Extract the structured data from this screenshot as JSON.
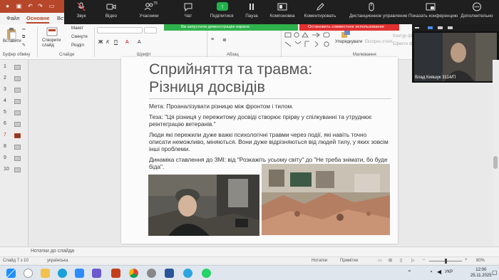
{
  "zoom": {
    "buttons": [
      {
        "label": "Звук",
        "icon": "mic-muted-icon"
      },
      {
        "label": "Відео",
        "icon": "video-camera-icon"
      },
      {
        "label": "Учасники",
        "icon": "participants-icon",
        "count": "75"
      },
      {
        "label": "Чат",
        "icon": "chat-icon"
      },
      {
        "label": "Поділитися",
        "icon": "share-screen-icon"
      },
      {
        "label": "Пауза",
        "icon": "pause-icon"
      },
      {
        "label": "Компоновка",
        "icon": "layout-icon"
      },
      {
        "label": "Коментировать",
        "icon": "annotate-icon"
      },
      {
        "label": "Дистанционное управление",
        "icon": "remote-control-icon"
      },
      {
        "label": "Показать конференцию",
        "icon": "show-meeting-icon"
      },
      {
        "label": "Дополнительно",
        "icon": "more-icon"
      }
    ],
    "share_banner": "Ви запустили демонстрацію екрана",
    "stop_share": "Остановить совместное использование",
    "participant_name": "Влад Кияшук 3114/П"
  },
  "ppt": {
    "tabs": [
      "Файл",
      "Основне",
      "Вст"
    ],
    "ribbon": {
      "paste": "Вставити",
      "new_slide": "Створити слайд",
      "layout": "Макет",
      "reset": "Скинути",
      "section": "Розділ",
      "arrange": "Упорядкувати",
      "quick_styles": "Експрес-стилі",
      "shape_outline": "Контур фігури",
      "shape_effects": "Ефекти фігур",
      "groups": {
        "clipboard": "Буфер обміну",
        "slides": "Слайди",
        "font": "Шрифт",
        "paragraph": "Абзац",
        "drawing": "Малювання"
      }
    },
    "slide_numbers": [
      "1",
      "2",
      "3",
      "4",
      "5",
      "6",
      "7",
      "8",
      "9",
      "10"
    ],
    "active_slide": "7",
    "slide": {
      "title_line1": "Сприйняття та травма:",
      "title_line2": "Різниця досвідів",
      "goal": "Мета: Проаналізувати різницю між фронтом і тилом.",
      "thesis": "Теза: \"Ця різниця у пережитому досвіді створює прірву у спілкуванні та утруднює реінтеграцію ветеранів.\"",
      "paragraph": "Люди які пережили дуже важкі психологічні травми через події, які навіть точно описати неможливо, міняються. Вони дуже відрізняються від людей тилу, у яких зовсім інші проблеми.",
      "media": "Динаміка ставлення до ЗМІ: від \"Розкажіть усьому світу\" до \"Не треба знімати, бо буде біда\"."
    },
    "notes_placeholder": "Нотатки до слайда",
    "status": {
      "slide_counter": "Слайд 7 з 10",
      "language": "українська",
      "notes": "Нотатки",
      "comments": "Примітки",
      "zoom": "80%"
    }
  },
  "taskbar": {
    "language": "УКР",
    "time": "12:00",
    "date": "25.11.2025"
  }
}
